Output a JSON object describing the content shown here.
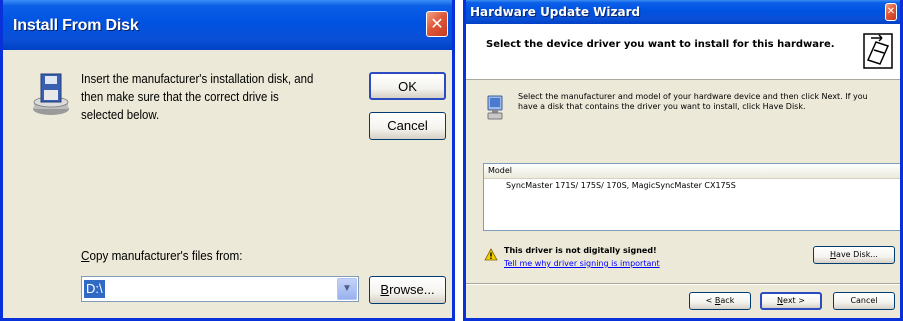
{
  "install_dialog": {
    "title": "Install From Disk",
    "close_glyph": "✕",
    "message": "Insert the manufacturer's installation disk, and then make sure that the correct drive is selected below.",
    "ok_label": "OK",
    "cancel_label": "Cancel",
    "copy_label_first": "C",
    "copy_label_rest": "opy manufacturer's files from:",
    "path_value": "D:\\",
    "browse_label_first": "B",
    "browse_label_rest": "rowse...",
    "icons": {
      "disk": "floppy-disk-install-icon",
      "combo_arrow": "chevron-down-icon"
    },
    "colors": {
      "titlebar": "#0053e1",
      "body": "#ece9d8",
      "selection": "#316ac5"
    }
  },
  "wizard": {
    "title": "Hardware Update Wizard",
    "close_glyph": "✕",
    "header_title": "Select the device driver you want to install for this hardware.",
    "description": "Select the manufacturer and model of your hardware device and then click Next. If you have a disk that contains the driver you want to install, click Have Disk.",
    "model_column": "Model",
    "models": [
      "SyncMaster 171S/ 175S/ 170S, MagicSyncMaster CX175S"
    ],
    "warning_text": "This driver is not digitally signed!",
    "warning_link": "Tell me why driver signing is important",
    "have_disk_first": "H",
    "have_disk_rest": "ave Disk...",
    "back_prefix": "< ",
    "back_underlined": "B",
    "back_rest": "ack",
    "next_underlined": "N",
    "next_rest": "ext >",
    "cancel_label": "Cancel",
    "icons": {
      "header": "hardware-wizard-icon",
      "device": "monitor-icon",
      "warning": "warning-icon"
    }
  }
}
